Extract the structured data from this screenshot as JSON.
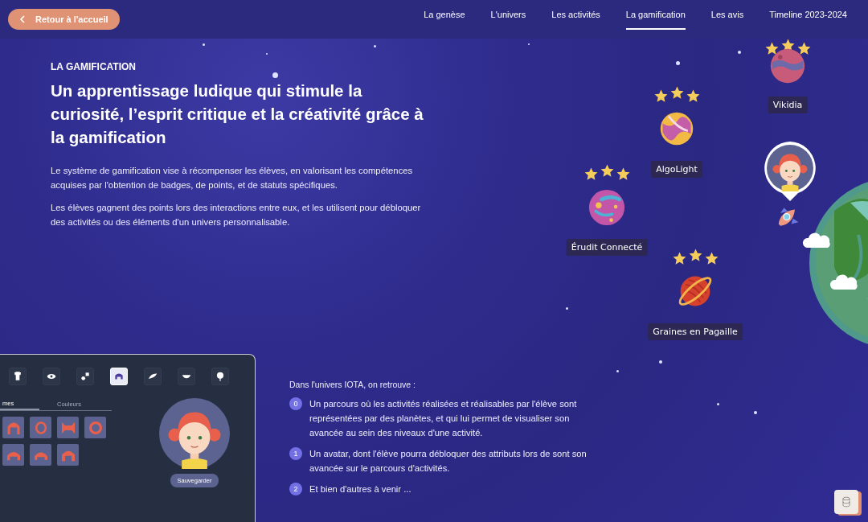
{
  "nav": {
    "back_button": "Retour à l'accueil",
    "links": [
      {
        "label": "La genèse",
        "selected": false
      },
      {
        "label": "L'univers",
        "selected": false
      },
      {
        "label": "Les activités",
        "selected": false
      },
      {
        "label": "La gamification",
        "selected": true
      },
      {
        "label": "Les avis",
        "selected": false
      },
      {
        "label": "Timeline 2023-2024",
        "selected": false
      }
    ]
  },
  "hero": {
    "eyebrow": "LA GAMIFICATION",
    "title": "Un apprentissage ludique qui stimule la curiosité, l’esprit critique et la créativité grâce à la gamification",
    "paragraphs": [
      "Le système de gamification vise à récompenser les élèves, en valorisant les compétences acquises par l'obtention de badges, de points, et de statuts spécifiques.",
      "Les élèves gagnent des points lors des interactions entre eux, et les utilisent pour débloquer des activités ou des éléments d'un univers personnalisable."
    ]
  },
  "path_map": {
    "planets": [
      {
        "name": "Vikidia",
        "stars": 3,
        "kind": "marbled"
      },
      {
        "name": "AlgoLight",
        "stars": 3,
        "kind": "swirl"
      },
      {
        "name": "Érudit Connecté",
        "stars": 3,
        "kind": "dotted"
      },
      {
        "name": "Graines en Pagaille",
        "stars": 3,
        "kind": "ringed"
      }
    ]
  },
  "avatar_editor": {
    "toolbar": [
      {
        "kind": "shirt",
        "selected": false
      },
      {
        "kind": "eye",
        "selected": false
      },
      {
        "kind": "pieces",
        "selected": false
      },
      {
        "kind": "hair",
        "selected": true
      },
      {
        "kind": "brow",
        "selected": false
      },
      {
        "kind": "mouth",
        "selected": false
      },
      {
        "kind": "balloon",
        "selected": false
      }
    ],
    "tabs": [
      {
        "label": "mes",
        "selected": true
      },
      {
        "label": "Couleurs",
        "selected": false
      }
    ],
    "save_button": "Sauvegarder"
  },
  "universe": {
    "intro": "Dans l'univers IOTA, on retrouve :",
    "items": [
      {
        "number": "0",
        "text": "Un parcours où les activités réalisées et réalisables par l'élève sont représentées par des planètes, et qui lui permet de visualiser son avancée au sein des niveaux d'une activité."
      },
      {
        "number": "1",
        "text": "Un avatar, dont l'élève pourra débloquer des attributs lors de sont son avancée sur le parcours d'activités."
      },
      {
        "number": "2",
        "text": "Et bien d'autres à venir ..."
      }
    ]
  }
}
